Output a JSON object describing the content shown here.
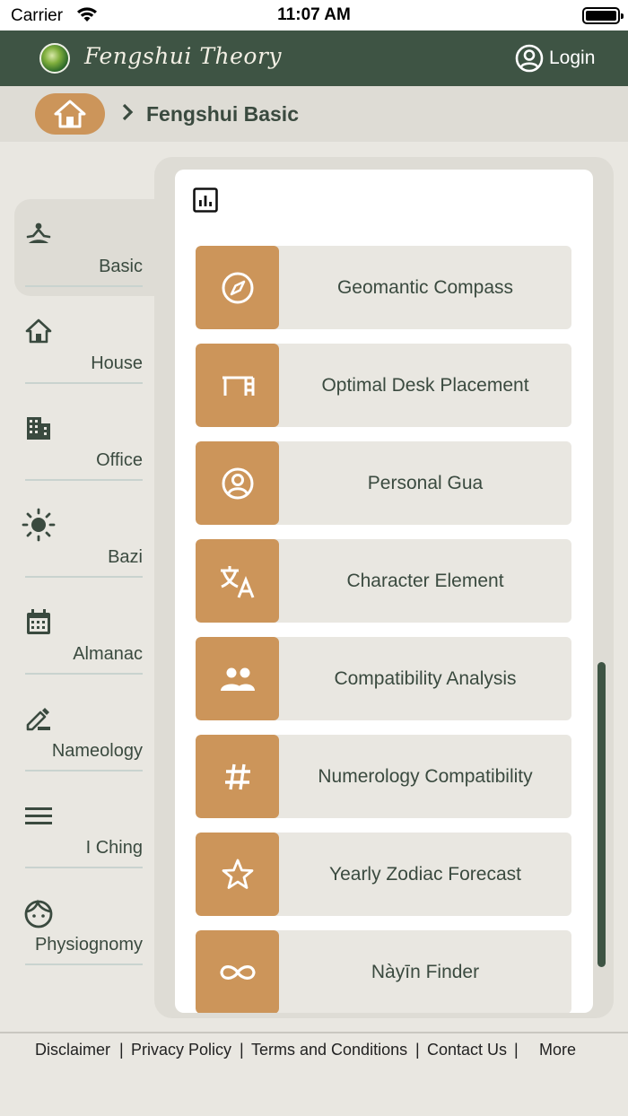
{
  "status_bar": {
    "carrier": "Carrier",
    "time": "11:07 AM"
  },
  "header": {
    "brand": "Fengshui Theory",
    "login_label": "Login"
  },
  "breadcrumb": {
    "current": "Fengshui Basic"
  },
  "sidebar": {
    "items": [
      {
        "label": "Basic",
        "icon": "meditation-icon",
        "active": true
      },
      {
        "label": "House",
        "icon": "house-icon"
      },
      {
        "label": "Office",
        "icon": "office-building-icon"
      },
      {
        "label": "Bazi",
        "icon": "sun-icon"
      },
      {
        "label": "Almanac",
        "icon": "calendar-icon"
      },
      {
        "label": "Nameology",
        "icon": "pencil-icon"
      },
      {
        "label": "I Ching",
        "icon": "menu-lines-icon"
      },
      {
        "label": "Physiognomy",
        "icon": "face-icon"
      }
    ]
  },
  "main": {
    "cards": [
      {
        "label": "Geomantic Compass",
        "icon": "compass-icon"
      },
      {
        "label": "Optimal Desk Placement",
        "icon": "desk-icon"
      },
      {
        "label": "Personal Gua",
        "icon": "person-icon"
      },
      {
        "label": "Character Element",
        "icon": "translate-icon"
      },
      {
        "label": "Compatibility Analysis",
        "icon": "people-icon"
      },
      {
        "label": "Numerology Compatibility",
        "icon": "hash-icon"
      },
      {
        "label": "Yearly Zodiac Forecast",
        "icon": "star-icon"
      },
      {
        "label": "Nàyīn Finder",
        "icon": "infinity-icon"
      }
    ]
  },
  "footer": {
    "links": [
      "Disclaimer",
      "Privacy Policy",
      "Terms and Conditions",
      "Contact Us",
      "More"
    ],
    "separator": "|"
  },
  "colors": {
    "header": "#3e5444",
    "accent": "#cc955a",
    "background": "#e9e7e1",
    "card": "#e9e7e1"
  }
}
